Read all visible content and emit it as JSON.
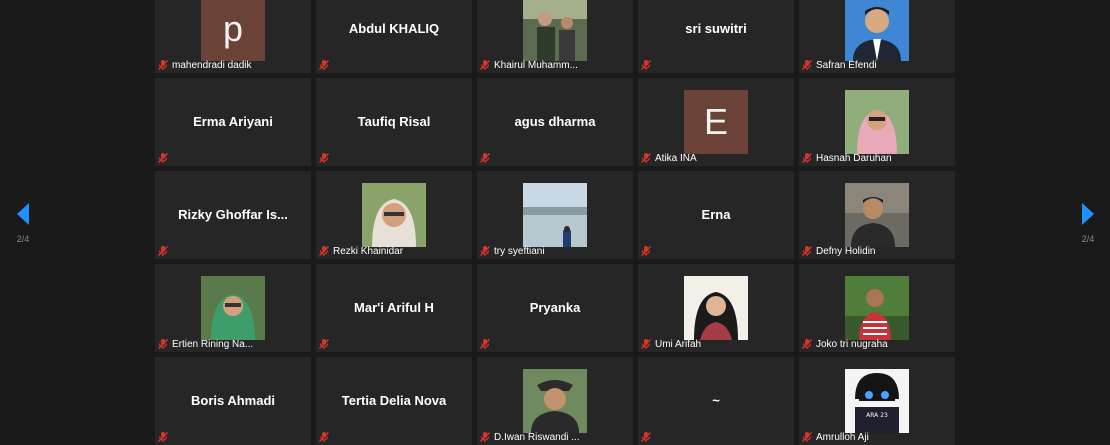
{
  "colors": {
    "background": "#1a1a1a",
    "tile": "#262626",
    "letter_avatar": "#6b4238",
    "muted_icon": "#d9342b",
    "nav_arrow": "#1e90ff"
  },
  "nav": {
    "prev_icon": "chevron-left-icon",
    "next_icon": "chevron-right-icon",
    "page_indicator_left": "2/4",
    "page_indicator_right": "2/4"
  },
  "participants": [
    {
      "name": "mahendradi dadik",
      "label": "mahendradi dadik",
      "video": "letter",
      "letter": "p"
    },
    {
      "name": "Abdul KHALIQ",
      "label": "",
      "video": "name"
    },
    {
      "name": "Khairul Muhammad",
      "label": "Khairul Muhamm...",
      "video": "photo"
    },
    {
      "name": "sri suwitri",
      "label": "",
      "video": "name"
    },
    {
      "name": "Safran Efendi",
      "label": "Safran Efendi",
      "video": "photo"
    },
    {
      "name": "Erma Ariyani",
      "label": "",
      "video": "name"
    },
    {
      "name": "Taufiq Risal",
      "label": "",
      "video": "name"
    },
    {
      "name": "agus dharma",
      "label": "",
      "video": "name"
    },
    {
      "name": "Atika INA",
      "label": "Atika INA",
      "video": "letter",
      "letter": "E"
    },
    {
      "name": "Hasnah Daruhan",
      "label": "Hasnah Daruhan",
      "video": "photo"
    },
    {
      "name": "Rizky Ghoffar Is...",
      "label": "",
      "video": "name"
    },
    {
      "name": "Rezki Khainidar",
      "label": "Rezki Khainidar",
      "video": "photo"
    },
    {
      "name": "try syeftiani",
      "label": "try syeftiani",
      "video": "photo"
    },
    {
      "name": "Erna",
      "label": "",
      "video": "name"
    },
    {
      "name": "Defny Holidin",
      "label": "Defny Holidin",
      "video": "photo"
    },
    {
      "name": "Ertien Rining Na...",
      "label": "Ertien Rining Na...",
      "video": "photo"
    },
    {
      "name": "Mar'i Ariful H",
      "label": "",
      "video": "name"
    },
    {
      "name": "Pryanka",
      "label": "",
      "video": "name"
    },
    {
      "name": "Umi Arifah",
      "label": "Umi Arifah",
      "video": "photo"
    },
    {
      "name": "Joko tri nugraha",
      "label": "Joko tri nugraha",
      "video": "photo"
    },
    {
      "name": "Boris Ahmadi",
      "label": "",
      "video": "name"
    },
    {
      "name": "Tertia Delia Nova",
      "label": "",
      "video": "name"
    },
    {
      "name": "D.Iwan Riswandi",
      "label": "D.Iwan Riswandi ...",
      "video": "photo"
    },
    {
      "name": "~",
      "label": "",
      "video": "name"
    },
    {
      "name": "Amrulloh Aji",
      "label": "Amrulloh Aji",
      "video": "photo",
      "photo_text": "ARA 23"
    }
  ]
}
